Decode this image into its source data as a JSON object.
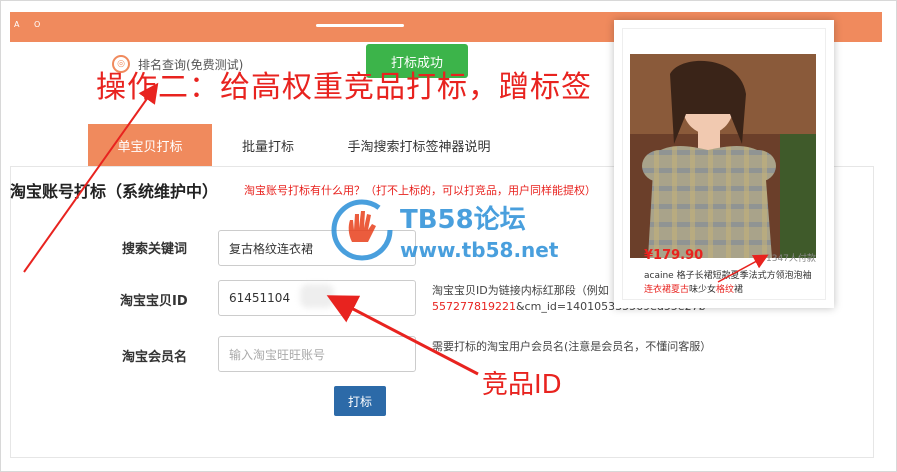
{
  "topbar": {
    "dots": "A O"
  },
  "rank": {
    "icon": "rank-icon",
    "label": "排名查询(免费测试)"
  },
  "success_button": "打标成功",
  "annotation_top": "操作二：给高权重竞品打标，蹭标签",
  "tabs": [
    {
      "label": "单宝贝打标",
      "active": true
    },
    {
      "label": "批量打标",
      "active": false
    },
    {
      "label": "手淘搜索打标签神器说明",
      "active": false
    }
  ],
  "section": {
    "title": "淘宝账号打标（系统维护中）",
    "hint": "淘宝账号打标有什么用？（打不上标的，可以打竞品，用户同样能提权）"
  },
  "form": {
    "keyword_label": "搜索关键词",
    "keyword_value": "复古格纹连衣裙",
    "id_label": "淘宝宝贝ID",
    "id_value": "61451104",
    "id_help_line1": "淘宝宝贝ID为链接内标红那段（例如",
    "id_help_red": "557277819221",
    "id_help_rest": "&cm_id=140105335569ed55e27b",
    "member_label": "淘宝会员名",
    "member_placeholder": "输入淘宝旺旺账号",
    "member_help": "需要打标的淘宝用户会员名(注意是会员名，不懂问客服）",
    "submit_label": "打标"
  },
  "annotation_id": "竞品ID",
  "watermark": {
    "title": "TB58论坛",
    "url": "www.tb58.net"
  },
  "product": {
    "price": "¥179.90",
    "sold": "1347人付款",
    "title_line1": "acaine 格子长裙短款夏季法式方领泡泡袖",
    "title_red1": "连衣裙夏古",
    "title_mid": "味少女",
    "title_red2": "格纹",
    "title_end": "裙"
  },
  "colors": {
    "accent": "#f08a5d",
    "success": "#3cb44a",
    "annotation": "#e8231f",
    "submit": "#2c6aa8",
    "watermark": "#2a8fd8"
  }
}
